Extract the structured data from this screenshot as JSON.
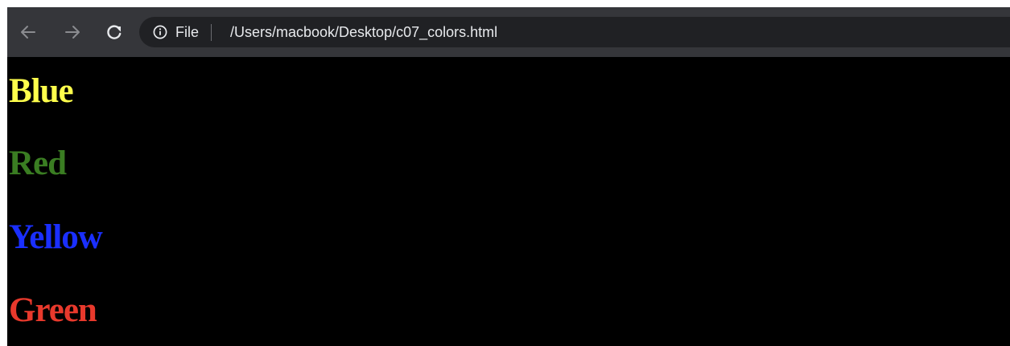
{
  "browser": {
    "omnibox": {
      "scheme_label": "File",
      "url": "/Users/macbook/Desktop/c07_colors.html"
    },
    "colors": {
      "toolbar_bg": "#35363a",
      "omnibox_bg": "#202124",
      "icon_inactive": "#8b8c90",
      "icon_active": "#e8eaed"
    }
  },
  "page": {
    "background": "#000000",
    "items": [
      {
        "text": "Blue",
        "color": "#ffff4c"
      },
      {
        "text": "Red",
        "color": "#3a7d22"
      },
      {
        "text": "Yellow",
        "color": "#1a2fff"
      },
      {
        "text": "Green",
        "color": "#e8392c"
      }
    ]
  }
}
